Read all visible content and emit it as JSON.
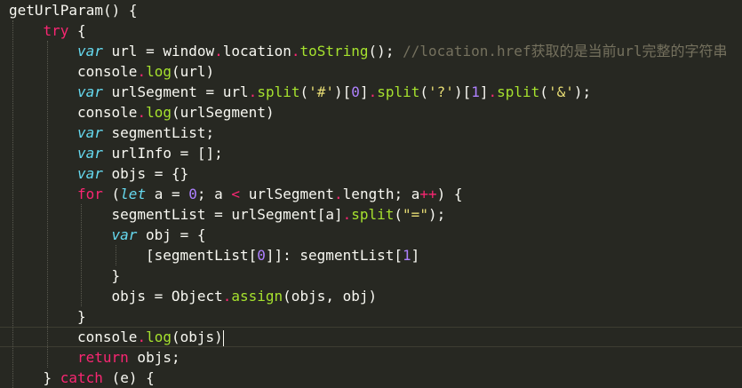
{
  "lines": [
    {
      "indent": 0,
      "tokens": [
        {
          "t": "getUrlParam() {",
          "c": ""
        }
      ]
    },
    {
      "indent": 1,
      "tokens": [
        {
          "t": "try",
          "c": "kw"
        },
        {
          "t": " {",
          "c": ""
        }
      ]
    },
    {
      "indent": 2,
      "tokens": [
        {
          "t": "var",
          "c": "storage"
        },
        {
          "t": " url = window",
          "c": ""
        },
        {
          "t": ".",
          "c": "dot"
        },
        {
          "t": "location",
          "c": ""
        },
        {
          "t": ".",
          "c": "dot"
        },
        {
          "t": "toString",
          "c": "fn"
        },
        {
          "t": "(); ",
          "c": ""
        },
        {
          "t": "//location.href获取的是当前url完整的字符串",
          "c": "cmt"
        }
      ]
    },
    {
      "indent": 2,
      "tokens": [
        {
          "t": "console",
          "c": ""
        },
        {
          "t": ".",
          "c": "dot"
        },
        {
          "t": "log",
          "c": "fn"
        },
        {
          "t": "(url)",
          "c": ""
        }
      ]
    },
    {
      "indent": 2,
      "tokens": [
        {
          "t": "var",
          "c": "storage"
        },
        {
          "t": " urlSegment = url",
          "c": ""
        },
        {
          "t": ".",
          "c": "dot"
        },
        {
          "t": "split",
          "c": "fn"
        },
        {
          "t": "(",
          "c": ""
        },
        {
          "t": "'#'",
          "c": "str"
        },
        {
          "t": ")[",
          "c": ""
        },
        {
          "t": "0",
          "c": "num"
        },
        {
          "t": "]",
          "c": ""
        },
        {
          "t": ".",
          "c": "dot"
        },
        {
          "t": "split",
          "c": "fn"
        },
        {
          "t": "(",
          "c": ""
        },
        {
          "t": "'?'",
          "c": "str"
        },
        {
          "t": ")[",
          "c": ""
        },
        {
          "t": "1",
          "c": "num"
        },
        {
          "t": "]",
          "c": ""
        },
        {
          "t": ".",
          "c": "dot"
        },
        {
          "t": "split",
          "c": "fn"
        },
        {
          "t": "(",
          "c": ""
        },
        {
          "t": "'&'",
          "c": "str"
        },
        {
          "t": ");",
          "c": ""
        }
      ]
    },
    {
      "indent": 2,
      "tokens": [
        {
          "t": "console",
          "c": ""
        },
        {
          "t": ".",
          "c": "dot"
        },
        {
          "t": "log",
          "c": "fn"
        },
        {
          "t": "(urlSegment)",
          "c": ""
        }
      ]
    },
    {
      "indent": 2,
      "tokens": [
        {
          "t": "var",
          "c": "storage"
        },
        {
          "t": " segmentList;",
          "c": ""
        }
      ]
    },
    {
      "indent": 2,
      "tokens": [
        {
          "t": "var",
          "c": "storage"
        },
        {
          "t": " urlInfo = [];",
          "c": ""
        }
      ]
    },
    {
      "indent": 2,
      "tokens": [
        {
          "t": "var",
          "c": "storage"
        },
        {
          "t": " objs = {}",
          "c": ""
        }
      ]
    },
    {
      "indent": 2,
      "tokens": [
        {
          "t": "for",
          "c": "kw"
        },
        {
          "t": " (",
          "c": ""
        },
        {
          "t": "let",
          "c": "storage"
        },
        {
          "t": " a = ",
          "c": ""
        },
        {
          "t": "0",
          "c": "num"
        },
        {
          "t": "; a ",
          "c": ""
        },
        {
          "t": "<",
          "c": "kw"
        },
        {
          "t": " urlSegment",
          "c": ""
        },
        {
          "t": ".",
          "c": "dot"
        },
        {
          "t": "length; a",
          "c": ""
        },
        {
          "t": "++",
          "c": "kw"
        },
        {
          "t": ") {",
          "c": ""
        }
      ]
    },
    {
      "indent": 3,
      "tokens": [
        {
          "t": "segmentList = urlSegment[a]",
          "c": ""
        },
        {
          "t": ".",
          "c": "dot"
        },
        {
          "t": "split",
          "c": "fn"
        },
        {
          "t": "(",
          "c": ""
        },
        {
          "t": "\"=\"",
          "c": "str"
        },
        {
          "t": ");",
          "c": ""
        }
      ]
    },
    {
      "indent": 3,
      "tokens": [
        {
          "t": "var",
          "c": "storage"
        },
        {
          "t": " obj = {",
          "c": ""
        }
      ]
    },
    {
      "indent": 4,
      "tokens": [
        {
          "t": "[segmentList[",
          "c": ""
        },
        {
          "t": "0",
          "c": "num"
        },
        {
          "t": "]]: segmentList[",
          "c": ""
        },
        {
          "t": "1",
          "c": "num"
        },
        {
          "t": "]",
          "c": ""
        }
      ]
    },
    {
      "indent": 3,
      "tokens": [
        {
          "t": "}",
          "c": ""
        }
      ]
    },
    {
      "indent": 3,
      "tokens": [
        {
          "t": "objs = Object",
          "c": ""
        },
        {
          "t": ".",
          "c": "dot"
        },
        {
          "t": "assign",
          "c": "fn"
        },
        {
          "t": "(objs, obj)",
          "c": ""
        }
      ]
    },
    {
      "indent": 2,
      "tokens": [
        {
          "t": "}",
          "c": ""
        }
      ]
    },
    {
      "indent": 2,
      "current": true,
      "tokens": [
        {
          "t": "console",
          "c": ""
        },
        {
          "t": ".",
          "c": "dot"
        },
        {
          "t": "log",
          "c": "fn"
        },
        {
          "t": "(objs)",
          "c": ""
        }
      ]
    },
    {
      "indent": 2,
      "tokens": [
        {
          "t": "return",
          "c": "kw"
        },
        {
          "t": " objs;",
          "c": ""
        }
      ]
    },
    {
      "indent": 1,
      "tokens": [
        {
          "t": "} ",
          "c": ""
        },
        {
          "t": "catch",
          "c": "kw"
        },
        {
          "t": " (e) {",
          "c": ""
        }
      ]
    }
  ],
  "colors": {
    "background": "#272822",
    "text": "#f8f8f2",
    "keyword": "#f92672",
    "storage": "#66d9ef",
    "function": "#a6e22e",
    "number": "#ae81ff",
    "string": "#e6db74",
    "comment": "#75715e"
  }
}
